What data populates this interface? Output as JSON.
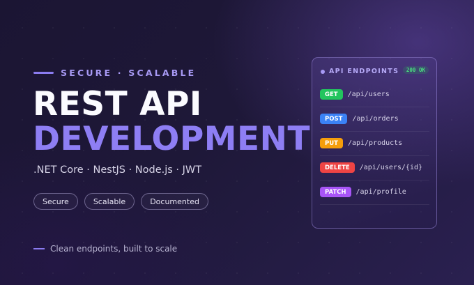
{
  "hero": {
    "eyebrow": "SECURE · SCALABLE",
    "title_line1": "REST API",
    "title_line2": "DEVELOPMENT",
    "stack": ".NET Core · NestJS · Node.js · JWT",
    "chips": [
      "Secure",
      "Scalable",
      "Documented"
    ],
    "tagline": "Clean endpoints, built to scale"
  },
  "panel": {
    "title": "API ENDPOINTS",
    "status": "200 OK",
    "endpoints": [
      {
        "method": "GET",
        "path": "/api/users",
        "color": "#22c55e"
      },
      {
        "method": "POST",
        "path": "/api/orders",
        "color": "#3b82f6"
      },
      {
        "method": "PUT",
        "path": "/api/products",
        "color": "#f59e0b"
      },
      {
        "method": "DELETE",
        "path": "/api/users/{id}",
        "color": "#ef4444"
      },
      {
        "method": "PATCH",
        "path": "/api/profile",
        "color": "#a855f7"
      }
    ]
  },
  "colors": {
    "accent": "#8b7cf0",
    "background": "#1e1838"
  }
}
